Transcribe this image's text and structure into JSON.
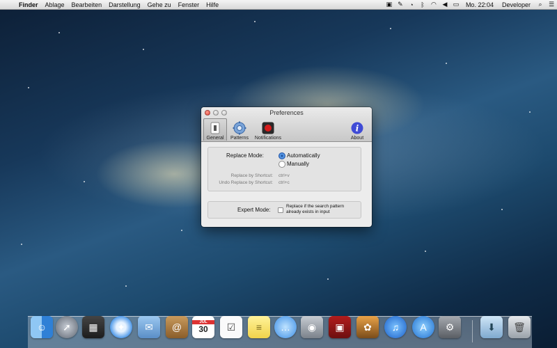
{
  "menubar": {
    "apple_glyph": "",
    "items": [
      "Finder",
      "Ablage",
      "Bearbeiten",
      "Darstellung",
      "Gehe zu",
      "Fenster",
      "Hilfe"
    ],
    "clock": "Mo. 22:04",
    "user": "Developer"
  },
  "window": {
    "title": "Preferences",
    "tabs": [
      {
        "label": "General",
        "icon": "switch-icon"
      },
      {
        "label": "Patterns",
        "icon": "gear-icon"
      },
      {
        "label": "Notifications",
        "icon": "record-icon"
      },
      {
        "label": "About",
        "icon": "info-icon"
      }
    ],
    "replace_mode_label": "Replace Mode:",
    "option_automatic": "Automatically",
    "option_manual": "Manually",
    "replace_shortcut_label": "Replace by Shortcut:",
    "replace_shortcut_value": "ctrl+v",
    "undo_shortcut_label": "Undo Replace by Shortcut:",
    "undo_shortcut_value": "ctrl+c",
    "expert_mode_label": "Expert Mode:",
    "expert_text_line1": "Replace if the search pattern",
    "expert_text_line2": "already exists in input"
  },
  "dock": {
    "apps": [
      "finder",
      "launchpad",
      "mission-control",
      "safari",
      "mail",
      "contacts",
      "calendar",
      "reminders",
      "notes",
      "messages",
      "facetime",
      "photo-booth",
      "iphoto",
      "itunes",
      "app-store",
      "system-preferences",
      "downloads",
      "trash"
    ],
    "calendar_day": "30",
    "calendar_month": "JUL"
  },
  "colors": {
    "accent": "#2f6fc9",
    "close": "#e0443a",
    "record": "#d51b1b",
    "info": "#3f4bd6"
  }
}
